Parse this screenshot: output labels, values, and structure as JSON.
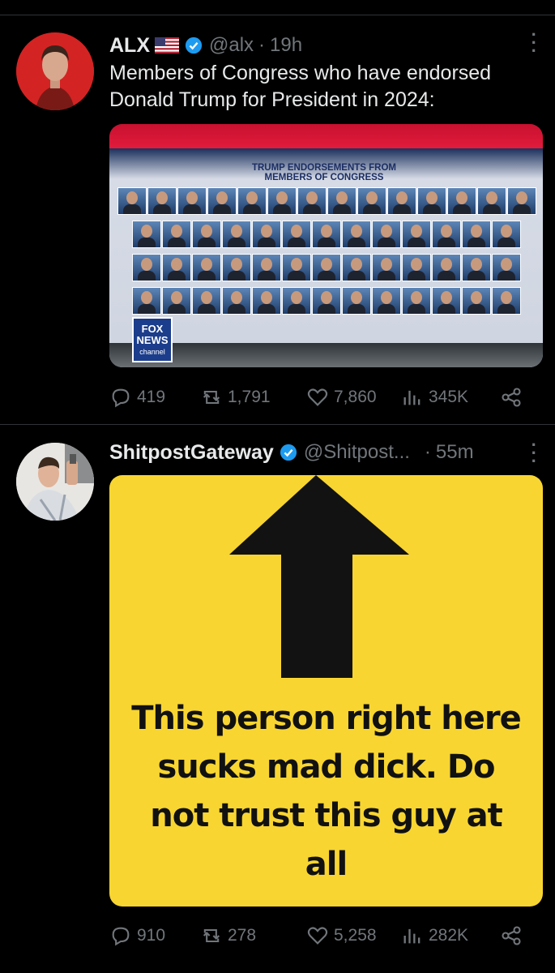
{
  "tweets": [
    {
      "name": "ALX",
      "handle": "@alx",
      "time": "19h",
      "text": "Members of Congress who have endorsed Donald Trump for President in 2024:",
      "media": {
        "headline_line1": "TRUMP ENDORSEMENTS FROM",
        "headline_line2": "MEMBERS OF CONGRESS",
        "logo_line1": "FOX",
        "logo_line2": "NEWS",
        "logo_line3": "channel"
      },
      "stats": {
        "replies": "419",
        "reposts": "1,791",
        "likes": "7,860",
        "views": "345K"
      }
    },
    {
      "name": "ShitpostGateway",
      "handle": "@Shitpost...",
      "time": "55m",
      "media": {
        "caption": "This person right here sucks mad dick. Do not trust this guy at all"
      },
      "stats": {
        "replies": "910",
        "reposts": "278",
        "likes": "5,258",
        "views": "282K"
      }
    }
  ],
  "colors": {
    "accent": "#1d9bf0",
    "muted": "#71767b",
    "meme_yellow": "#f8d531",
    "fox_red": "#c8102e"
  },
  "icons": [
    "reply-icon",
    "repost-icon",
    "like-icon",
    "views-icon",
    "share-icon",
    "verified-badge-icon",
    "us-flag-icon",
    "more-icon"
  ]
}
